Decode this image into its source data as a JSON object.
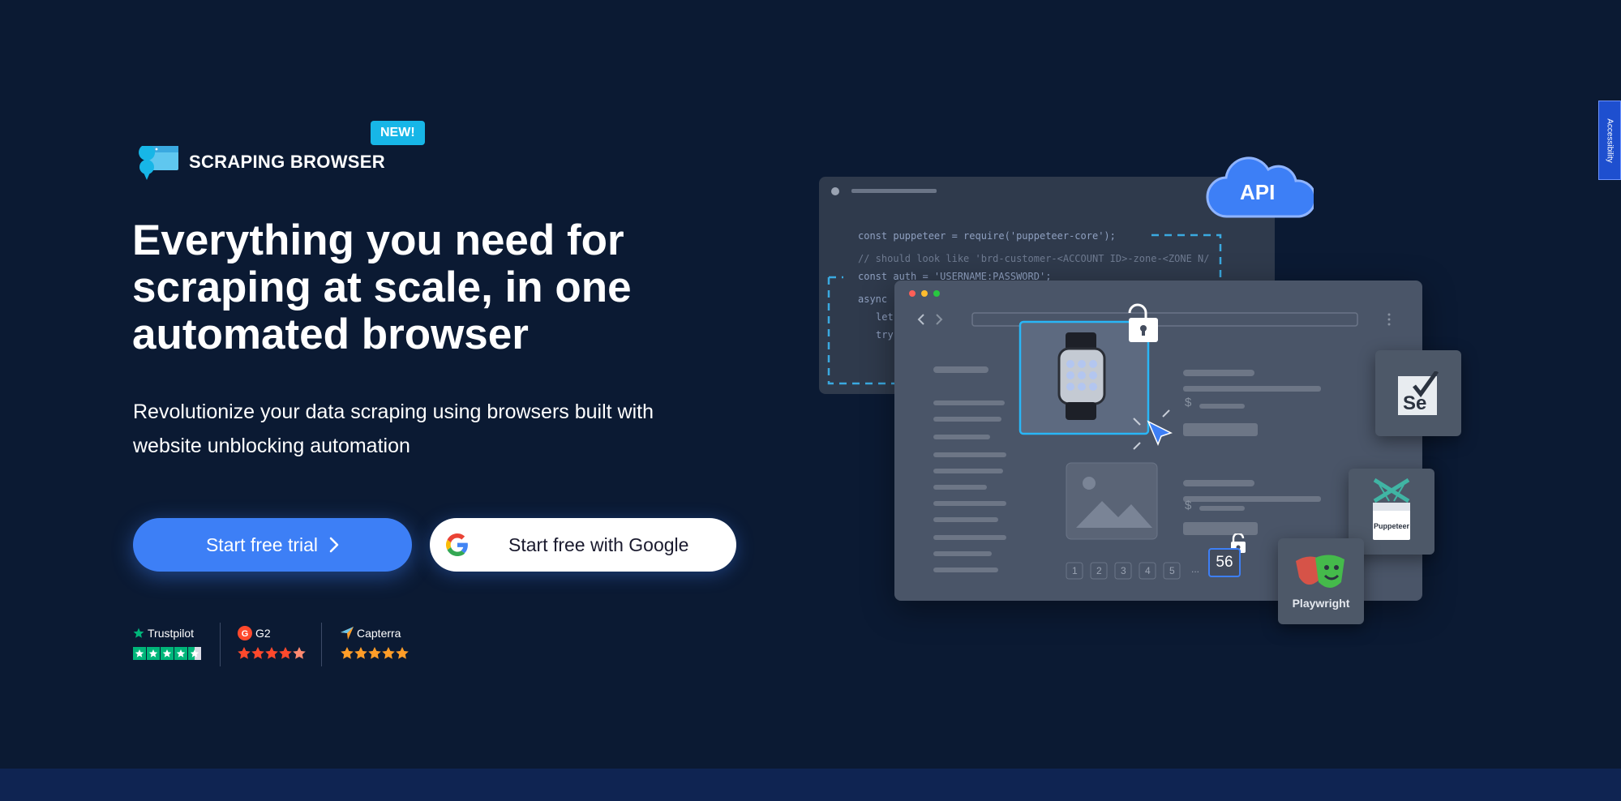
{
  "product": {
    "name": "SCRAPING BROWSER",
    "badge": "NEW!"
  },
  "hero": {
    "headline": "Everything you need for scraping at scale, in one automated browser",
    "subhead": "Revolutionize your data scraping using browsers built with website unblocking automation"
  },
  "buttons": {
    "trial_label": "Start free trial",
    "google_label": "Start free with Google"
  },
  "ratings": [
    {
      "name": "Trustpilot",
      "stars": 4.5
    },
    {
      "name": "G2",
      "stars": 4.5
    },
    {
      "name": "Capterra",
      "stars": 5
    }
  ],
  "accessibility": {
    "label": "Accessibility"
  },
  "illustration": {
    "api_label": "API",
    "code_lines": [
      "const puppeteer = require('puppeteer-core');",
      "// should look like 'brd-customer-<ACCOUNT ID>-zone-<ZONE N/",
      "const auth = 'USERNAME:PASSWORD';",
      "async",
      "let",
      "try"
    ],
    "pagination": [
      "1",
      "2",
      "3",
      "4",
      "5",
      "..."
    ],
    "counter": "56",
    "tools": {
      "selenium": "Se",
      "puppeteer": "Puppeteer",
      "playwright": "Playwright"
    }
  },
  "colors": {
    "background": "#0b1a33",
    "accent": "#3d7ff6",
    "badge": "#17b6e7",
    "trustpilot": "#00b67a",
    "g2": "#ff492c",
    "capterra": "#ff9d28"
  }
}
